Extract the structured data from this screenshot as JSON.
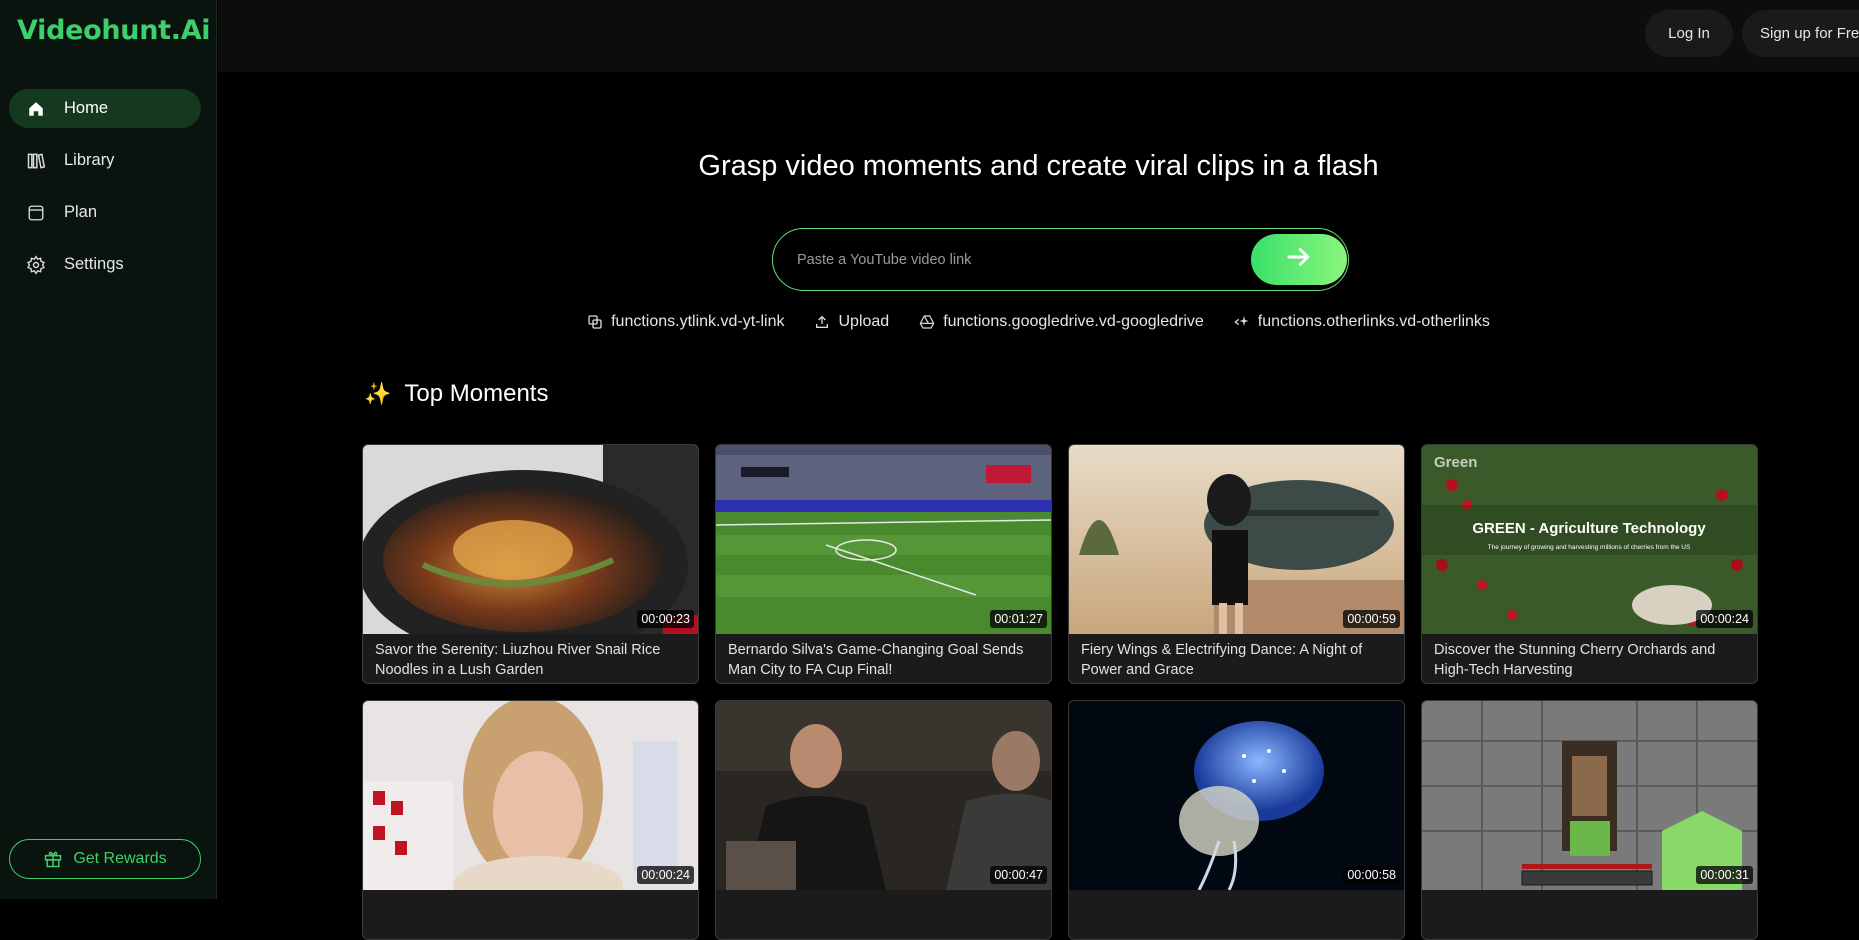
{
  "brand": "Videohunt.Ai",
  "sidebar": {
    "items": [
      {
        "label": "Home",
        "icon": "home-icon"
      },
      {
        "label": "Library",
        "icon": "library-icon"
      },
      {
        "label": "Plan",
        "icon": "plan-icon"
      },
      {
        "label": "Settings",
        "icon": "gear-icon"
      }
    ],
    "rewards_label": "Get Rewards"
  },
  "header": {
    "login_label": "Log In",
    "signup_label": "Sign up for Free"
  },
  "hero": {
    "title": "Grasp video moments and create viral clips in a flash",
    "search_placeholder": "Paste a YouTube video link"
  },
  "sources": [
    {
      "label": "functions.ytlink.vd-yt-link",
      "icon": "link-icon"
    },
    {
      "label": "Upload",
      "icon": "upload-icon"
    },
    {
      "label": "functions.googledrive.vd-googledrive",
      "icon": "google-drive-icon"
    },
    {
      "label": "functions.otherlinks.vd-otherlinks",
      "icon": "sparkle-link-icon"
    }
  ],
  "section": {
    "title": "Top Moments",
    "icon": "sparkles-icon"
  },
  "moments": [
    {
      "duration": "00:00:23",
      "title": "Savor the Serenity: Liuzhou River Snail Rice Noodles in a Lush Garden"
    },
    {
      "duration": "00:01:27",
      "title": "Bernardo Silva's Game-Changing Goal Sends Man City to FA Cup Final!"
    },
    {
      "duration": "00:00:59",
      "title": "Fiery Wings & Electrifying Dance: A Night of Power and Grace"
    },
    {
      "duration": "00:00:24",
      "title": "Discover the Stunning Cherry Orchards and High-Tech Harvesting",
      "overlay_title": "GREEN - Agriculture Technology",
      "overlay_sub": "The journey of growing and harvesting millions of cherries from the US",
      "overlay_logo": "Green"
    },
    {
      "duration": "00:00:24",
      "title": ""
    },
    {
      "duration": "00:00:47",
      "title": ""
    },
    {
      "duration": "00:00:58",
      "title": ""
    },
    {
      "duration": "00:00:31",
      "title": ""
    }
  ],
  "colors": {
    "accent": "#3ecf6a",
    "sidebar_bg": "#0a140e",
    "active_nav": "#14391f",
    "card_bg": "#1b1b1b"
  }
}
